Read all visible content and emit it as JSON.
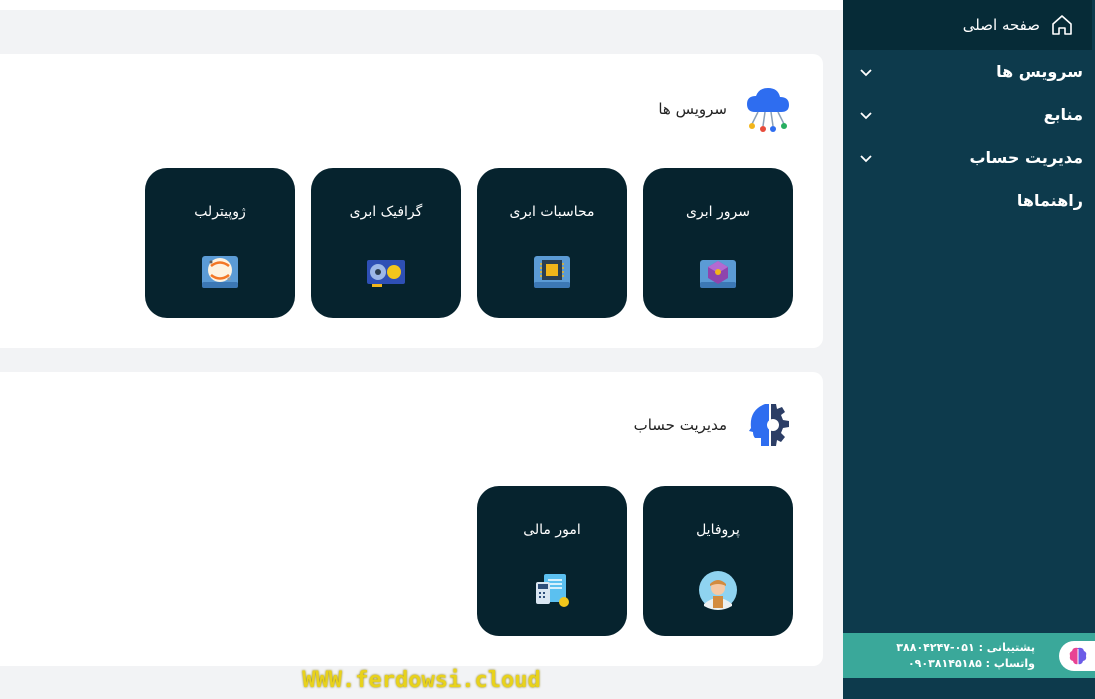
{
  "sidebar": {
    "items": [
      {
        "label": "صفحه اصلی",
        "icon": "home-icon"
      },
      {
        "label": "سرویس ها",
        "icon": "chevron-down-icon"
      },
      {
        "label": "منابع",
        "icon": "chevron-down-icon"
      },
      {
        "label": "مدیریت حساب",
        "icon": "chevron-down-icon"
      },
      {
        "label": "راهنماها"
      }
    ],
    "support": {
      "line1": "پشتیبانی : ۰۵۱-۳۸۸۰۴۲۴۷",
      "line2": "واتساپ : ۰۹۰۳۸۱۴۵۱۸۵"
    }
  },
  "services": {
    "title": "سرویس ها",
    "tiles": [
      {
        "label": "سرور ابری",
        "icon": "server-icon"
      },
      {
        "label": "محاسبات ابری",
        "icon": "cpu-icon"
      },
      {
        "label": "گرافیک ابری",
        "icon": "gpu-icon"
      },
      {
        "label": "ژوپیترلب",
        "icon": "jupyter-icon"
      }
    ]
  },
  "account": {
    "title": "مدیریت حساب",
    "tiles": [
      {
        "label": "پروفایل",
        "icon": "profile-icon"
      },
      {
        "label": "امور مالی",
        "icon": "finance-icon"
      }
    ]
  },
  "watermark": "WWW.ferdowsi.cloud",
  "colors": {
    "sidebar_bg": "#0d3a4c",
    "tile_bg": "#06232e",
    "support_bg": "#3aa89a",
    "watermark": "#e8d21b"
  }
}
